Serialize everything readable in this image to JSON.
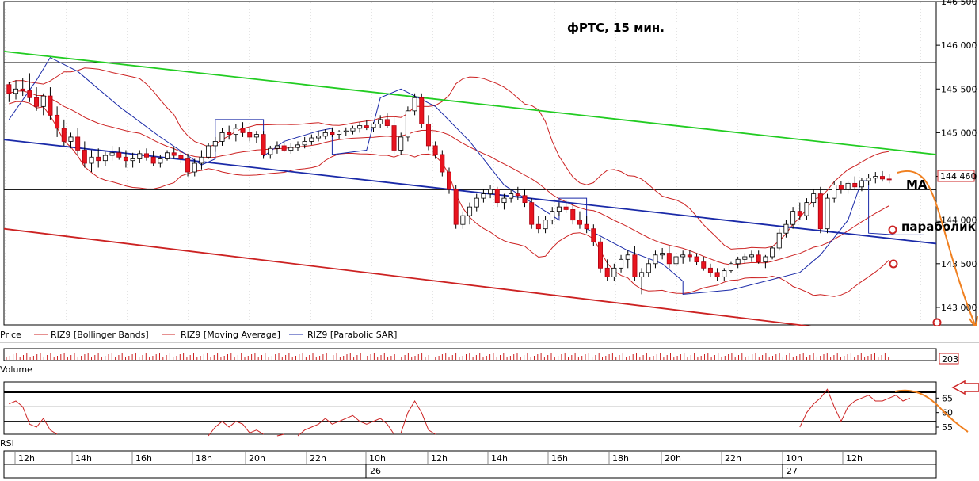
{
  "chart_data": {
    "type": "candlestick",
    "title": "фРТС,  15 мин.",
    "instrument": "RIZ9",
    "price_axis": {
      "ylim": [
        142800,
        146500
      ],
      "ticks": [
        "146 500",
        "146 000",
        "145 500",
        "145 000",
        "144 500",
        "144 000",
        "143 500",
        "143 000"
      ]
    },
    "last_price_label": "144 460",
    "legend": [
      {
        "label": "Price",
        "color": "#000000"
      },
      {
        "label": "RIZ9 [Bollinger Bands]",
        "color": "#cc2222"
      },
      {
        "label": "RIZ9 [Moving Average]",
        "color": "#cc2222"
      },
      {
        "label": "RIZ9 [Parabolic SAR]",
        "color": "#1a2aa8"
      }
    ],
    "annotations": [
      "MA",
      "параболик"
    ],
    "volume_panel": {
      "label": "Volume",
      "last_value_label": "203"
    },
    "rsi_panel": {
      "label": "RSI",
      "ticks": [
        "65",
        "60",
        "55"
      ],
      "levels": [
        67,
        62,
        57
      ]
    },
    "time_axis": {
      "hour_labels": [
        "12h",
        "14h",
        "16h",
        "18h",
        "20h",
        "22h",
        "10h",
        "12h",
        "14h",
        "16h",
        "18h",
        "20h",
        "22h",
        "10h",
        "12h"
      ],
      "date_labels": [
        "26",
        "27"
      ]
    },
    "horizontal_levels": [
      145800,
      144350
    ],
    "trend_lines": [
      {
        "color": "#22cc22",
        "from": 145930,
        "to": 144750
      },
      {
        "color": "#1a2aa8",
        "from": 144920,
        "to": 143730
      },
      {
        "color": "#cc2222",
        "from": 143900,
        "to": 142610
      }
    ],
    "candles": [
      [
        145550,
        145580,
        145350,
        145450
      ],
      [
        145450,
        145600,
        145380,
        145500
      ],
      [
        145500,
        145620,
        145420,
        145480
      ],
      [
        145480,
        145680,
        145350,
        145400
      ],
      [
        145400,
        145520,
        145250,
        145300
      ],
      [
        145300,
        145450,
        145200,
        145420
      ],
      [
        145420,
        145520,
        145150,
        145200
      ],
      [
        145200,
        145300,
        144950,
        145050
      ],
      [
        145050,
        145150,
        144850,
        144900
      ],
      [
        144900,
        145000,
        144820,
        144950
      ],
      [
        144950,
        145050,
        144750,
        144800
      ],
      [
        144800,
        144900,
        144600,
        144650
      ],
      [
        144650,
        144800,
        144550,
        144720
      ],
      [
        144720,
        144820,
        144600,
        144680
      ],
      [
        144680,
        144780,
        144620,
        144740
      ],
      [
        144740,
        144850,
        144680,
        144770
      ],
      [
        144770,
        144830,
        144690,
        144720
      ],
      [
        144720,
        144800,
        144600,
        144680
      ],
      [
        144680,
        144770,
        144600,
        144700
      ],
      [
        144700,
        144800,
        144650,
        144760
      ],
      [
        144760,
        144820,
        144680,
        144720
      ],
      [
        144720,
        144790,
        144620,
        144650
      ],
      [
        144650,
        144750,
        144600,
        144700
      ],
      [
        144700,
        144800,
        144680,
        144770
      ],
      [
        144770,
        144830,
        144700,
        144740
      ],
      [
        144740,
        144790,
        144650,
        144700
      ],
      [
        144700,
        144760,
        144500,
        144550
      ],
      [
        144550,
        144700,
        144500,
        144650
      ],
      [
        144650,
        144800,
        144580,
        144720
      ],
      [
        144720,
        144880,
        144700,
        144850
      ],
      [
        144850,
        144950,
        144780,
        144900
      ],
      [
        144900,
        145050,
        144850,
        145000
      ],
      [
        145000,
        145080,
        144920,
        144980
      ],
      [
        144980,
        145100,
        144900,
        145050
      ],
      [
        145050,
        145120,
        144950,
        145000
      ],
      [
        145000,
        145050,
        144900,
        144950
      ],
      [
        144950,
        145020,
        144880,
        144980
      ],
      [
        144980,
        145020,
        144700,
        144750
      ],
      [
        144750,
        144850,
        144700,
        144820
      ],
      [
        144820,
        144900,
        144760,
        144850
      ],
      [
        144850,
        144900,
        144780,
        144800
      ],
      [
        144800,
        144880,
        144760,
        144830
      ],
      [
        144830,
        144900,
        144790,
        144860
      ],
      [
        144860,
        144950,
        144820,
        144900
      ],
      [
        144900,
        144980,
        144860,
        144940
      ],
      [
        144940,
        145020,
        144900,
        144960
      ],
      [
        144960,
        145040,
        144920,
        145000
      ],
      [
        145000,
        145060,
        144950,
        144980
      ],
      [
        144980,
        145030,
        144930,
        145010
      ],
      [
        145010,
        145060,
        144960,
        145020
      ],
      [
        145020,
        145080,
        144980,
        145050
      ],
      [
        145050,
        145120,
        145000,
        145080
      ],
      [
        145080,
        145140,
        145030,
        145060
      ],
      [
        145060,
        145120,
        145010,
        145100
      ],
      [
        145100,
        145200,
        145050,
        145150
      ],
      [
        145150,
        145220,
        145050,
        145080
      ],
      [
        145080,
        145180,
        144750,
        144800
      ],
      [
        144800,
        145000,
        144750,
        144950
      ],
      [
        144950,
        145300,
        144900,
        145250
      ],
      [
        145250,
        145450,
        145200,
        145400
      ],
      [
        145400,
        145450,
        145050,
        145100
      ],
      [
        145100,
        145200,
        144800,
        144850
      ],
      [
        144850,
        144900,
        144700,
        144750
      ],
      [
        144750,
        144800,
        144500,
        144550
      ],
      [
        144550,
        144600,
        144300,
        144350
      ],
      [
        144350,
        144400,
        143900,
        143950
      ],
      [
        143950,
        144100,
        143900,
        144050
      ],
      [
        144050,
        144200,
        143950,
        144150
      ],
      [
        144150,
        144300,
        144100,
        144250
      ],
      [
        144250,
        144350,
        144200,
        144300
      ],
      [
        144300,
        144400,
        144250,
        144350
      ],
      [
        144350,
        144380,
        144150,
        144200
      ],
      [
        144200,
        144300,
        144120,
        144250
      ],
      [
        144250,
        144350,
        144200,
        144300
      ],
      [
        144300,
        144380,
        144230,
        144280
      ],
      [
        144280,
        144360,
        144150,
        144200
      ],
      [
        144200,
        144250,
        143900,
        143950
      ],
      [
        143950,
        144050,
        143850,
        143900
      ],
      [
        143900,
        144050,
        143850,
        144000
      ],
      [
        144000,
        144150,
        143950,
        144100
      ],
      [
        144100,
        144200,
        144050,
        144150
      ],
      [
        144150,
        144230,
        144080,
        144120
      ],
      [
        144120,
        144180,
        143950,
        144000
      ],
      [
        144000,
        144100,
        143900,
        143950
      ],
      [
        143950,
        144050,
        143850,
        143900
      ],
      [
        143900,
        143950,
        143700,
        143750
      ],
      [
        143750,
        143800,
        143400,
        143450
      ],
      [
        143450,
        143550,
        143300,
        143350
      ],
      [
        143350,
        143500,
        143300,
        143450
      ],
      [
        143450,
        143600,
        143400,
        143550
      ],
      [
        143550,
        143650,
        143450,
        143600
      ],
      [
        143600,
        143700,
        143300,
        143350
      ],
      [
        143350,
        143450,
        143150,
        143400
      ],
      [
        143400,
        143550,
        143350,
        143500
      ],
      [
        143500,
        143650,
        143450,
        143600
      ],
      [
        143600,
        143680,
        143550,
        143620
      ],
      [
        143620,
        143700,
        143450,
        143500
      ],
      [
        143500,
        143620,
        143400,
        143580
      ],
      [
        143580,
        143650,
        143500,
        143600
      ],
      [
        143600,
        143650,
        143520,
        143580
      ],
      [
        143580,
        143620,
        143480,
        143520
      ],
      [
        143520,
        143580,
        143420,
        143450
      ],
      [
        143450,
        143500,
        143350,
        143400
      ],
      [
        143400,
        143450,
        143300,
        143350
      ],
      [
        143350,
        143450,
        143300,
        143420
      ],
      [
        143420,
        143520,
        143400,
        143500
      ],
      [
        143500,
        143580,
        143450,
        143550
      ],
      [
        143550,
        143620,
        143500,
        143580
      ],
      [
        143580,
        143650,
        143520,
        143600
      ],
      [
        143600,
        143650,
        143500,
        143520
      ],
      [
        143520,
        143600,
        143450,
        143580
      ],
      [
        143580,
        143700,
        143550,
        143680
      ],
      [
        143680,
        143900,
        143650,
        143850
      ],
      [
        143850,
        144000,
        143800,
        143950
      ],
      [
        143950,
        144150,
        143900,
        144100
      ],
      [
        144100,
        144200,
        144000,
        144050
      ],
      [
        144050,
        144250,
        144000,
        144200
      ],
      [
        144200,
        144350,
        144150,
        144300
      ],
      [
        144300,
        144380,
        143850,
        143900
      ],
      [
        143900,
        144300,
        143850,
        144250
      ],
      [
        144250,
        144450,
        144200,
        144400
      ],
      [
        144400,
        144450,
        144300,
        144350
      ],
      [
        144350,
        144450,
        144300,
        144420
      ],
      [
        144420,
        144500,
        144350,
        144380
      ],
      [
        144380,
        144480,
        144330,
        144450
      ],
      [
        144450,
        144530,
        144400,
        144480
      ],
      [
        144480,
        144550,
        144420,
        144500
      ],
      [
        144500,
        144560,
        144440,
        144470
      ],
      [
        144470,
        144530,
        144420,
        144460
      ]
    ],
    "parabolic_sar": [
      [
        0,
        145150
      ],
      [
        4,
        145600
      ],
      [
        6,
        145860
      ],
      [
        10,
        145700
      ],
      [
        16,
        145300
      ],
      [
        22,
        144950
      ],
      [
        28,
        144630
      ],
      [
        30,
        144700
      ],
      [
        30,
        145150
      ],
      [
        37,
        145150
      ],
      [
        37,
        144730
      ],
      [
        40,
        144900
      ],
      [
        45,
        145020
      ],
      [
        47,
        145050
      ],
      [
        47,
        144750
      ],
      [
        52,
        144800
      ],
      [
        54,
        145400
      ],
      [
        57,
        145500
      ],
      [
        62,
        145300
      ],
      [
        67,
        144900
      ],
      [
        72,
        144400
      ],
      [
        78,
        144100
      ],
      [
        80,
        144000
      ],
      [
        80,
        144250
      ],
      [
        84,
        144250
      ],
      [
        84,
        143900
      ],
      [
        90,
        143650
      ],
      [
        95,
        143500
      ],
      [
        98,
        143300
      ],
      [
        98,
        143150
      ],
      [
        105,
        143200
      ],
      [
        115,
        143400
      ],
      [
        118,
        143600
      ],
      [
        122,
        144000
      ],
      [
        124,
        144450
      ],
      [
        125,
        144450
      ],
      [
        125,
        143850
      ],
      [
        129,
        143830
      ],
      [
        133,
        143830
      ]
    ],
    "rsi_values": [
      63,
      64,
      62,
      56,
      55,
      58,
      54,
      50,
      48,
      46,
      47,
      45,
      47,
      46,
      48,
      46,
      45,
      44,
      46,
      47,
      46,
      44,
      45,
      47,
      48,
      47,
      45,
      46,
      48,
      52,
      55,
      57,
      55,
      57,
      56,
      53,
      54,
      47,
      50,
      52,
      50,
      51,
      52,
      54,
      55,
      56,
      58,
      56,
      57,
      58,
      59,
      57,
      56,
      57,
      58,
      56,
      50,
      53,
      60,
      64,
      60,
      54,
      50,
      47,
      44,
      38,
      40,
      42,
      44,
      45,
      46,
      44,
      45,
      46,
      45,
      44,
      40,
      39,
      40,
      42,
      43,
      42,
      40,
      39,
      38,
      34,
      31,
      30,
      32,
      34,
      36,
      33,
      31,
      34,
      36,
      37,
      36,
      35,
      36,
      35,
      34,
      33,
      32,
      31,
      32,
      34,
      36,
      38,
      40,
      41,
      40,
      41,
      43,
      46,
      50,
      55,
      60,
      63,
      65,
      68,
      62,
      57,
      62,
      64,
      65,
      66,
      64,
      64,
      65,
      66,
      64,
      65
    ]
  }
}
